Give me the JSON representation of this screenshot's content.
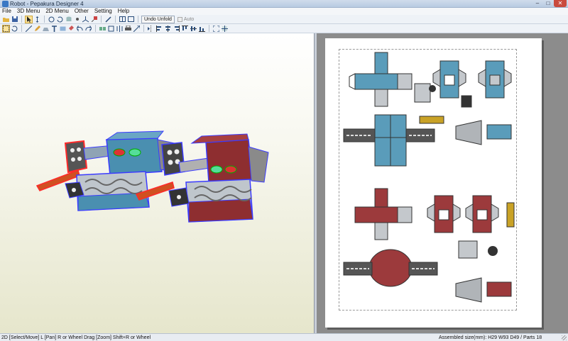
{
  "window": {
    "title": "Robot - Pepakura Designer 4",
    "controls": {
      "minimize": "–",
      "maximize": "□",
      "close": "✕"
    }
  },
  "menu": [
    "File",
    "3D Menu",
    "2D Menu",
    "Other",
    "Setting",
    "Help"
  ],
  "toolbar": {
    "undo_unfold_label": "Undo Unfold",
    "auto_label": "Auto",
    "auto_checked": false,
    "icons_row1": [
      "open-icon",
      "save-icon",
      "select-icon",
      "select-move-icon",
      "move-icon",
      "rotate-icon",
      "cylinder-icon",
      "point-icon",
      "axis-icon",
      "paint-icon",
      "link-icon",
      "split-view-icon",
      "window-icon"
    ],
    "icons_row2": [
      "select-rect-icon",
      "rotate-part-icon",
      "edge-icon",
      "pencil-icon",
      "flap-icon",
      "text-icon",
      "image-icon",
      "paint-bucket-icon",
      "undo-arrow-icon",
      "redo-arrow-icon",
      "join-icon",
      "move-part-icon",
      "split-icon",
      "print-icon",
      "scale-icon",
      "flip-icon",
      "align-left-icon",
      "align-center-icon",
      "align-right-icon",
      "align-top-icon",
      "align-middle-icon",
      "align-bottom-icon",
      "fit-icon",
      "zoom-icon"
    ]
  },
  "status": {
    "left": "2D [Select/Move] L [Pan] R or Wheel Drag [Zoom] Shift+R or Wheel",
    "right": "Assembled size(mm): H29 W93 D49 / Parts 18"
  },
  "colors": {
    "blue_model": "#4a8fb0",
    "red_model": "#8e2e30",
    "selection_outline": "#3b3bff",
    "flap_outline": "#ff2a2a",
    "paper": "#ffffff",
    "workspace_2d": "#8c8c8c"
  }
}
